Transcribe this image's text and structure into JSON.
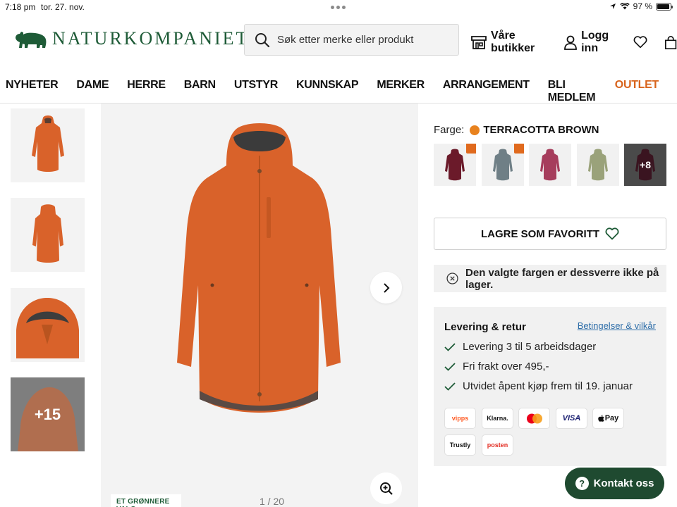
{
  "status_bar": {
    "time": "7:18 pm",
    "date": "tor. 27. nov.",
    "battery": "97 %",
    "battery_level": 0.97
  },
  "header": {
    "logo_text": "NATURKOMPANIET",
    "search_placeholder": "Søk etter merke eller produkt",
    "stores_label": "Våre butikker",
    "login_label": "Logg inn"
  },
  "nav": {
    "items": [
      "NYHETER",
      "DAME",
      "HERRE",
      "BARN",
      "UTSTYR",
      "KUNNSKAP",
      "MERKER",
      "ARRANGEMENT",
      "BLI MEDLEM"
    ],
    "outlet": "OUTLET",
    "outlet_color": "#d8641c"
  },
  "gallery": {
    "more_label": "+15",
    "counter": "1 / 20",
    "green_tag": "ET GRØNNERE VALG"
  },
  "product": {
    "color_label": "Farge:",
    "color_value": "TERRACOTTA BROWN",
    "color_dot": "#e8821e",
    "swatch_more": "+8",
    "favorite_button": "LAGRE SOM FAVORITT",
    "stock_message": "Den valgte fargen er dessverre ikke på lager."
  },
  "delivery": {
    "title": "Levering & retur",
    "terms_link": "Betingelser & vilkår",
    "items": [
      "Levering 3 til 5 arbeidsdager",
      "Fri frakt over 495,-",
      "Utvidet åpent kjøp frem til 19. januar"
    ]
  },
  "payments": {
    "vipps": "vipps",
    "klarna": "Klarna.",
    "visa": "VISA",
    "applepay": "Pay",
    "trustly": "Trustly",
    "posten": "posten"
  },
  "contact": {
    "label": "Kontakt oss",
    "icon": "?"
  },
  "brand_color": "#1e5b37"
}
